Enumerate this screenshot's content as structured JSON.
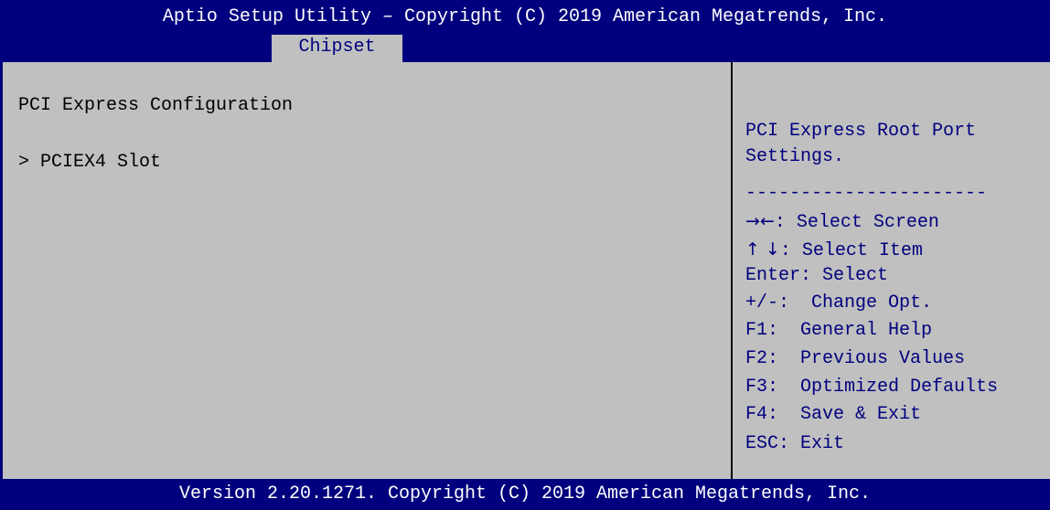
{
  "header": {
    "title": "Aptio Setup Utility – Copyright (C) 2019 American Megatrends, Inc.",
    "active_tab": "Chipset"
  },
  "main": {
    "section_title": "PCI Express Configuration",
    "items": [
      {
        "label": "> PCIEX4 Slot"
      }
    ]
  },
  "help": {
    "description_line1": "PCI Express Root Port",
    "description_line2": "Settings.",
    "separator": "----------------------",
    "keys": [
      {
        "key": "→←",
        "action": ": Select Screen"
      },
      {
        "key": "↑ ↓",
        "action": ": Select Item"
      },
      {
        "key": "Enter",
        "action": ": Select"
      },
      {
        "key": "+/-",
        "action": ":  Change Opt."
      },
      {
        "key": "F1",
        "action": ":  General Help"
      },
      {
        "key": "F2",
        "action": ":  Previous Values"
      },
      {
        "key": "F3",
        "action": ":  Optimized Defaults"
      },
      {
        "key": "F4",
        "action": ":  Save & Exit"
      },
      {
        "key": "ESC",
        "action": ": Exit"
      }
    ]
  },
  "footer": {
    "version": "Version 2.20.1271. Copyright (C) 2019 American Megatrends, Inc."
  },
  "colors": {
    "background": "#c0c0c0",
    "bar": "#00007f",
    "help_text": "#00007f"
  }
}
